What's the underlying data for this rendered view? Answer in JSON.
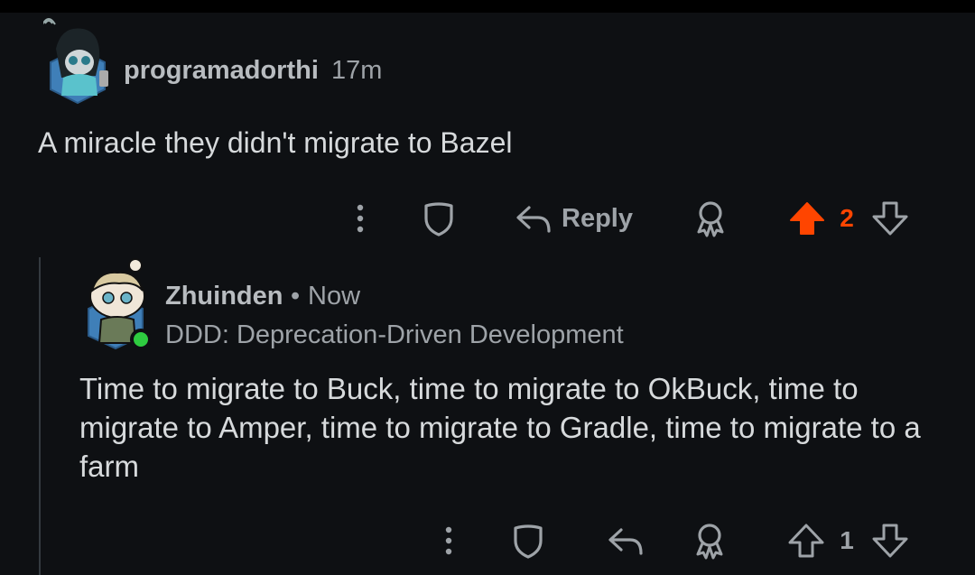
{
  "colors": {
    "background": "#0e1013",
    "text": "#d7dadc",
    "muted": "#9ea3a8",
    "upvote_active": "#ff4500",
    "online": "#2ecc40"
  },
  "comments": [
    {
      "username": "programadorthi",
      "time": "17m",
      "body": "A miracle they didn't migrate to Bazel",
      "actions": {
        "more_icon": "more-vertical-icon",
        "mod_icon": "shield-icon",
        "reply_label": "Reply",
        "award_icon": "award-icon",
        "vote_count": "2",
        "upvoted": true
      }
    },
    {
      "username": "Zhuinden",
      "separator": "•",
      "time": "Now",
      "flair": "DDD: Deprecation-Driven Development",
      "online": true,
      "body": "Time to migrate to Buck, time to migrate to OkBuck, time to migrate to Amper, time to migrate to Gradle, time to migrate to a farm",
      "actions": {
        "more_icon": "more-vertical-icon",
        "mod_icon": "shield-icon",
        "reply_icon": "reply-icon",
        "award_icon": "award-icon",
        "vote_count": "1",
        "upvoted": false
      }
    }
  ]
}
